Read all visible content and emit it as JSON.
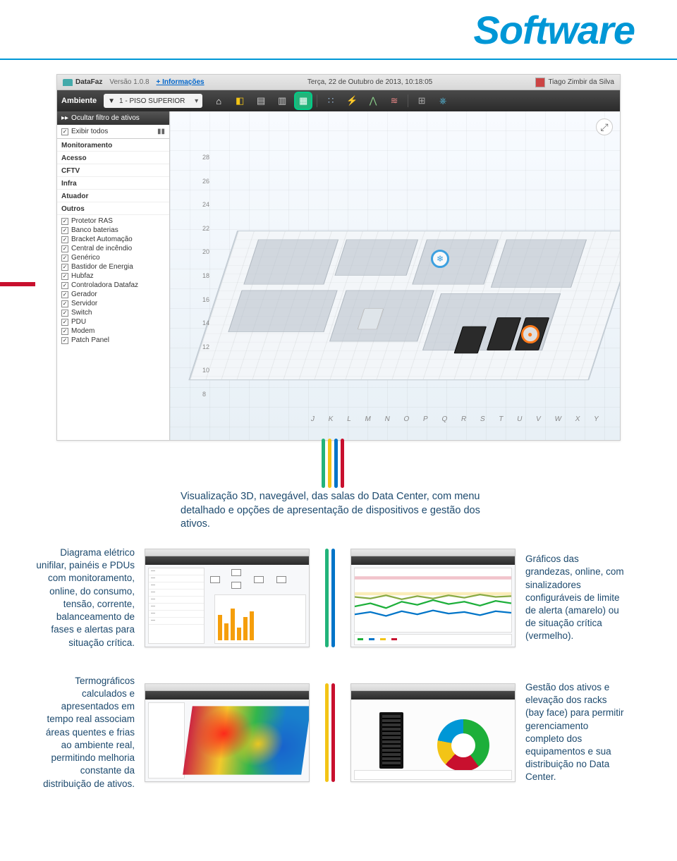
{
  "page": {
    "title": "Software"
  },
  "app": {
    "brand": "DataFaz",
    "version": "Versão 1.0.8",
    "info_link": "+ Informações",
    "datetime": "Terça, 22 de Outubro de 2013, 10:18:05",
    "user": "Tiago Zimbir da Silva",
    "nav_label": "Ambiente",
    "floor_selected": "1 - PISO SUPERIOR"
  },
  "sidebar": {
    "header": "Ocultar filtro de ativos",
    "show_all": "Exibir todos",
    "categories": [
      "Monitoramento",
      "Acesso",
      "CFTV",
      "Infra",
      "Atuador",
      "Outros"
    ],
    "items": [
      "Protetor RAS",
      "Banco baterias",
      "Bracket Automação",
      "Central de incêndio",
      "Genérico",
      "Bastidor de Energia",
      "Hubfaz",
      "Controladora Datafaz",
      "Gerador",
      "Servidor",
      "Switch",
      "PDU",
      "Modem",
      "Patch Panel"
    ]
  },
  "axis": {
    "letters": [
      "J",
      "K",
      "L",
      "M",
      "N",
      "O",
      "P",
      "Q",
      "R",
      "S",
      "T",
      "U",
      "V",
      "W",
      "X",
      "Y"
    ],
    "numbers": [
      "28",
      "26",
      "24",
      "22",
      "20",
      "18",
      "16",
      "14",
      "12",
      "10",
      "8"
    ]
  },
  "callout": {
    "main": "Visualização 3D, navegável, das salas do Data Center, com menu detalhado e opções de apresentação de dispositivos e gestão dos ativos."
  },
  "features": {
    "row1": {
      "left_text": "Diagrama elétrico unifilar, painéis e PDUs com monitoramento, online, do consumo, tensão, corrente, balanceamento de fases e alertas para situação crítica.",
      "right_text": "Gráficos das grandezas, online, com sinalizadores configuráveis de limite de alerta (amarelo) ou de situação crítica (vermelho)."
    },
    "row2": {
      "left_text": "Termográficos calculados e apresentados em tempo real associam áreas quentes e frias ao ambiente real, permitindo melhoria constante da distribuição de ativos.",
      "right_text": "Gestão dos ativos e elevação dos racks (bay face) para permitir gerenciamento completo dos equipamentos e sua distribuição no Data Center."
    }
  },
  "icons": {
    "home": "home-icon",
    "layers": "layers-icon",
    "db": "database-icon",
    "server": "server-icon",
    "grid": "grid-icon",
    "bolt": "bolt-icon",
    "chart": "chart-icon",
    "heat": "heat-icon",
    "pin": "pin-icon",
    "play": "play-icon",
    "chev": "chevron-down-icon",
    "fullscreen": "fullscreen-icon"
  }
}
